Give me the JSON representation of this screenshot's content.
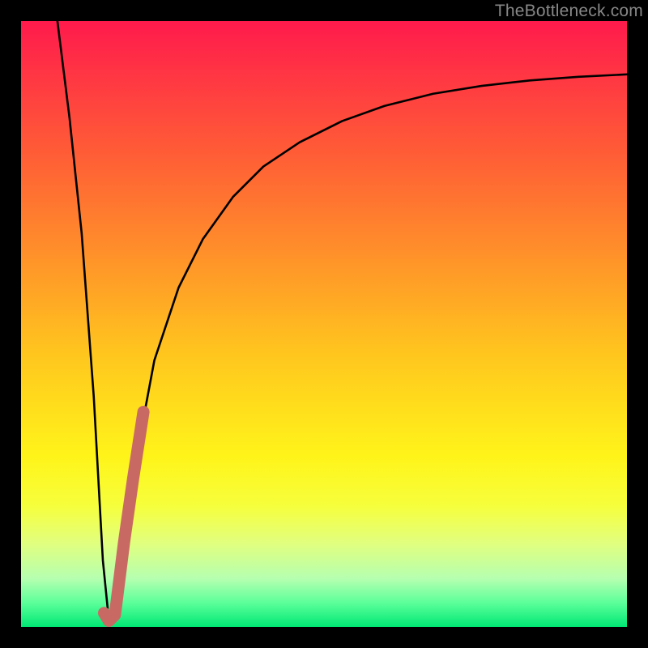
{
  "watermark": "TheBottleneck.com",
  "colors": {
    "frame": "#000000",
    "curve": "#000000",
    "highlight": "#c86a63",
    "gradient_top": "#ff1a4c",
    "gradient_bottom": "#00e874"
  },
  "chart_data": {
    "type": "line",
    "title": "",
    "xlabel": "",
    "ylabel": "",
    "xlim": [
      0,
      100
    ],
    "ylim": [
      0,
      100
    ],
    "grid": false,
    "legend": false,
    "series": [
      {
        "name": "bottleneck-curve",
        "x": [
          6,
          8,
          10,
          12,
          13.5,
          14.5,
          15.5,
          17,
          19,
          22,
          26,
          30,
          35,
          40,
          46,
          53,
          60,
          68,
          76,
          84,
          92,
          100
        ],
        "values": [
          100,
          84,
          65,
          38,
          11,
          1,
          2,
          14,
          28,
          44,
          56,
          64,
          71,
          76,
          80,
          83.5,
          86,
          88,
          89.3,
          90.2,
          90.8,
          91.2
        ]
      }
    ],
    "highlight_segment": {
      "series": "bottleneck-curve",
      "x": [
        13.7,
        14.5,
        15.5,
        17.0,
        18.5,
        20.2
      ],
      "values": [
        2.3,
        1.0,
        2.0,
        14.0,
        24.5,
        35.5
      ]
    }
  }
}
